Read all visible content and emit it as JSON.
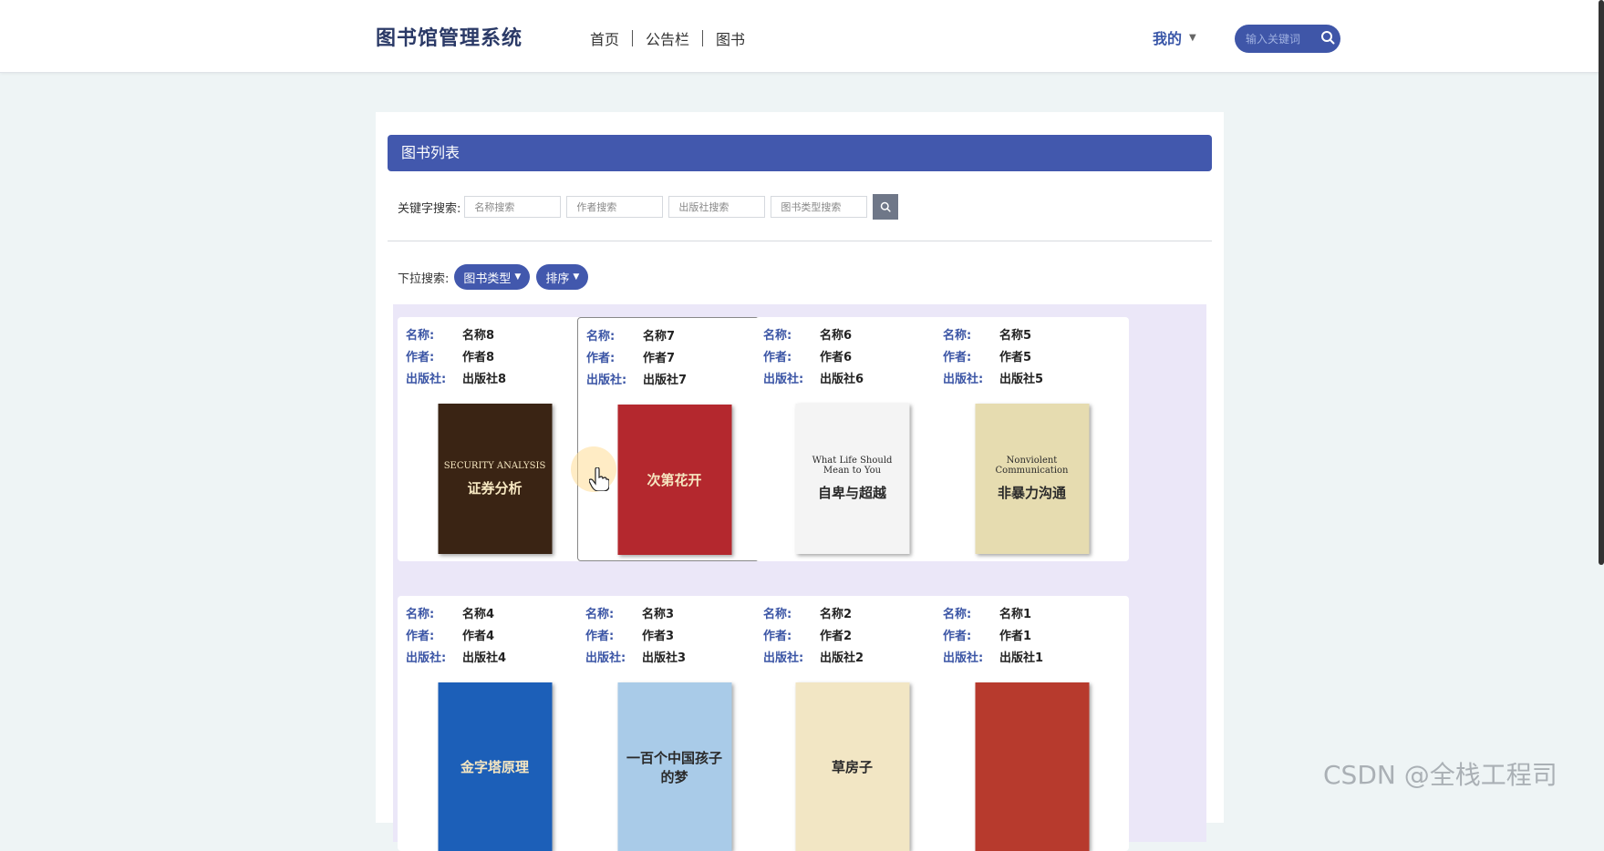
{
  "header": {
    "brand": "图书馆管理系统",
    "nav": [
      "首页",
      "公告栏",
      "图书"
    ],
    "user_menu": "我的",
    "search_placeholder": "输入关键词"
  },
  "panel": {
    "title": "图书列表",
    "keyword_label": "关键字搜索:",
    "inputs": [
      "名称搜索",
      "作者搜索",
      "出版社搜索",
      "图书类型搜索"
    ],
    "dropdown_label": "下拉搜索:",
    "dropdowns": [
      "图书类型",
      "排序"
    ]
  },
  "field_labels": {
    "name": "名称:",
    "author": "作者:",
    "publisher": "出版社:"
  },
  "books": [
    {
      "name": "名称8",
      "author": "作者8",
      "publisher": "出版社8",
      "cover_title": "证券分析",
      "cover_en": "SECURITY ANALYSIS",
      "cover_color": "#3a2414"
    },
    {
      "name": "名称7",
      "author": "作者7",
      "publisher": "出版社7",
      "cover_title": "次第花开",
      "cover_en": "",
      "cover_color": "#b4282e"
    },
    {
      "name": "名称6",
      "author": "作者6",
      "publisher": "出版社6",
      "cover_title": "自卑与超越",
      "cover_en": "What Life Should Mean to You",
      "cover_color": "#f4f4f4"
    },
    {
      "name": "名称5",
      "author": "作者5",
      "publisher": "出版社5",
      "cover_title": "非暴力沟通",
      "cover_en": "Nonviolent Communication",
      "cover_color": "#e6dcb0"
    },
    {
      "name": "名称4",
      "author": "作者4",
      "publisher": "出版社4",
      "cover_title": "金字塔原理",
      "cover_en": "",
      "cover_color": "#1c5fb8"
    },
    {
      "name": "名称3",
      "author": "作者3",
      "publisher": "出版社3",
      "cover_title": "一百个中国孩子的梦",
      "cover_en": "",
      "cover_color": "#a9cbe8"
    },
    {
      "name": "名称2",
      "author": "作者2",
      "publisher": "出版社2",
      "cover_title": "草房子",
      "cover_en": "",
      "cover_color": "#f2e6c4"
    },
    {
      "name": "名称1",
      "author": "作者1",
      "publisher": "出版社1",
      "cover_title": "",
      "cover_en": "",
      "cover_color": "#b73a2d"
    }
  ],
  "watermark": "CSDN @全栈工程司",
  "colors": {
    "primary": "#4258ad",
    "brand": "#2b3a67",
    "grid_bg": "#ebe7f8"
  }
}
